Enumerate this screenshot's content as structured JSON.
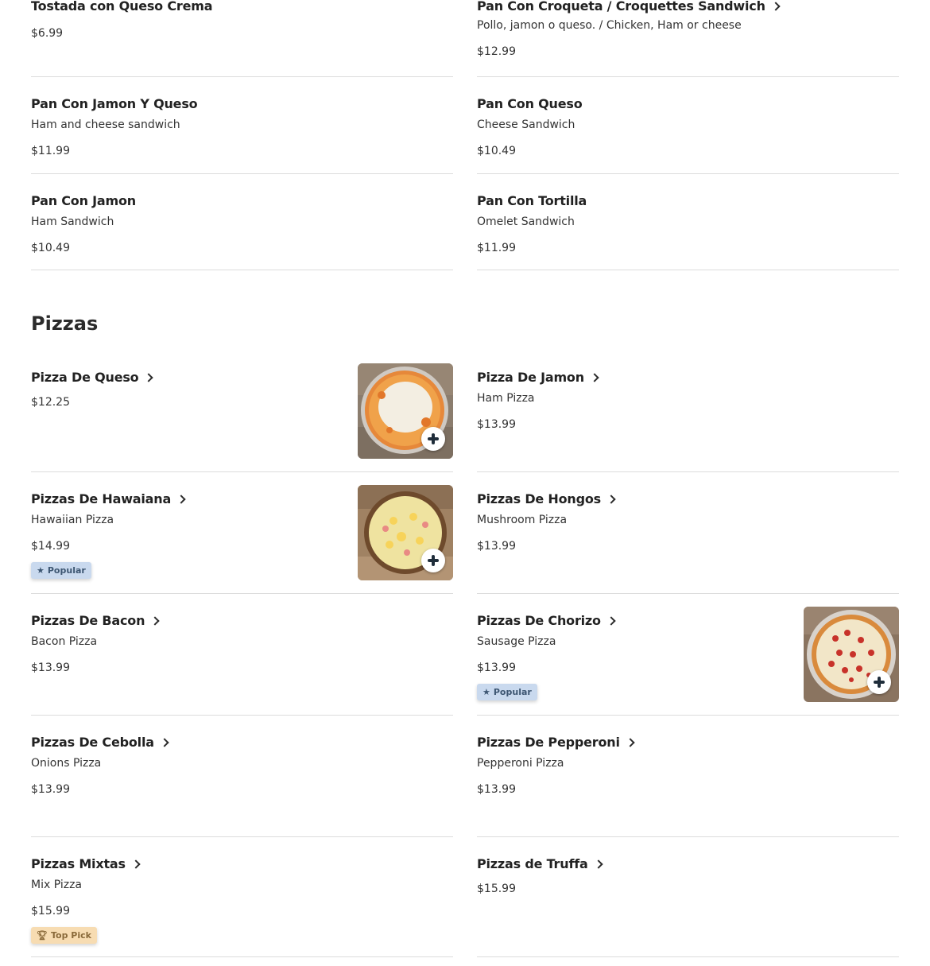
{
  "sandwiches": [
    {
      "name": "Tostada con Queso Crema",
      "description": "",
      "price": "$6.99",
      "arrow": false
    },
    {
      "name": "Pan Con Croqueta / Croquettes Sandwich",
      "description": "Pollo, jamon o queso. / Chicken, Ham or cheese",
      "price": "$12.99",
      "arrow": true
    },
    {
      "name": "Pan Con Jamon Y Queso",
      "description": "Ham and cheese sandwich",
      "price": "$11.99",
      "arrow": false
    },
    {
      "name": "Pan Con Queso",
      "description": "Cheese Sandwich",
      "price": "$10.49",
      "arrow": false
    },
    {
      "name": "Pan Con Jamon",
      "description": "Ham Sandwich",
      "price": "$10.49",
      "arrow": false
    },
    {
      "name": "Pan Con Tortilla",
      "description": "Omelet Sandwich",
      "price": "$11.99",
      "arrow": false
    }
  ],
  "pizzas_section": {
    "title": "Pizzas",
    "items": [
      {
        "name": "Pizza De Queso",
        "description": "",
        "price": "$12.25",
        "image": "cheese-pizza",
        "badge": ""
      },
      {
        "name": "Pizza De Jamon",
        "description": "Ham Pizza",
        "price": "$13.99",
        "image": "",
        "badge": ""
      },
      {
        "name": "Pizzas De Hawaiana",
        "description": "Hawaiian Pizza",
        "price": "$14.99",
        "image": "hawaiian-pizza",
        "badge": "Popular"
      },
      {
        "name": "Pizzas De Hongos",
        "description": "Mushroom Pizza",
        "price": "$13.99",
        "image": "",
        "badge": ""
      },
      {
        "name": "Pizzas De Bacon",
        "description": "Bacon Pizza",
        "price": "$13.99",
        "image": "",
        "badge": ""
      },
      {
        "name": "Pizzas De Chorizo",
        "description": "Sausage Pizza",
        "price": "$13.99",
        "image": "chorizo-pizza",
        "badge": "Popular"
      },
      {
        "name": "Pizzas De Cebolla",
        "description": "Onions Pizza",
        "price": "$13.99",
        "image": "",
        "badge": ""
      },
      {
        "name": "Pizzas De Pepperoni",
        "description": "Pepperoni Pizza",
        "price": "$13.99",
        "image": "",
        "badge": ""
      },
      {
        "name": "Pizzas Mixtas",
        "description": "Mix Pizza",
        "price": "$15.99",
        "image": "",
        "badge": "Top Pick"
      },
      {
        "name": "Pizzas de Truffa",
        "description": "",
        "price": "$15.99",
        "image": "",
        "badge": ""
      }
    ]
  },
  "icons": {
    "chevron": "chevron-right-icon",
    "add": "plus-icon",
    "popular": "star-icon",
    "top_pick": "trophy-icon"
  },
  "colors": {
    "popular_badge_bg": "#c9d9ee",
    "top_pick_badge_bg": "#f7dcb2",
    "divider": "#dcdcdc"
  }
}
